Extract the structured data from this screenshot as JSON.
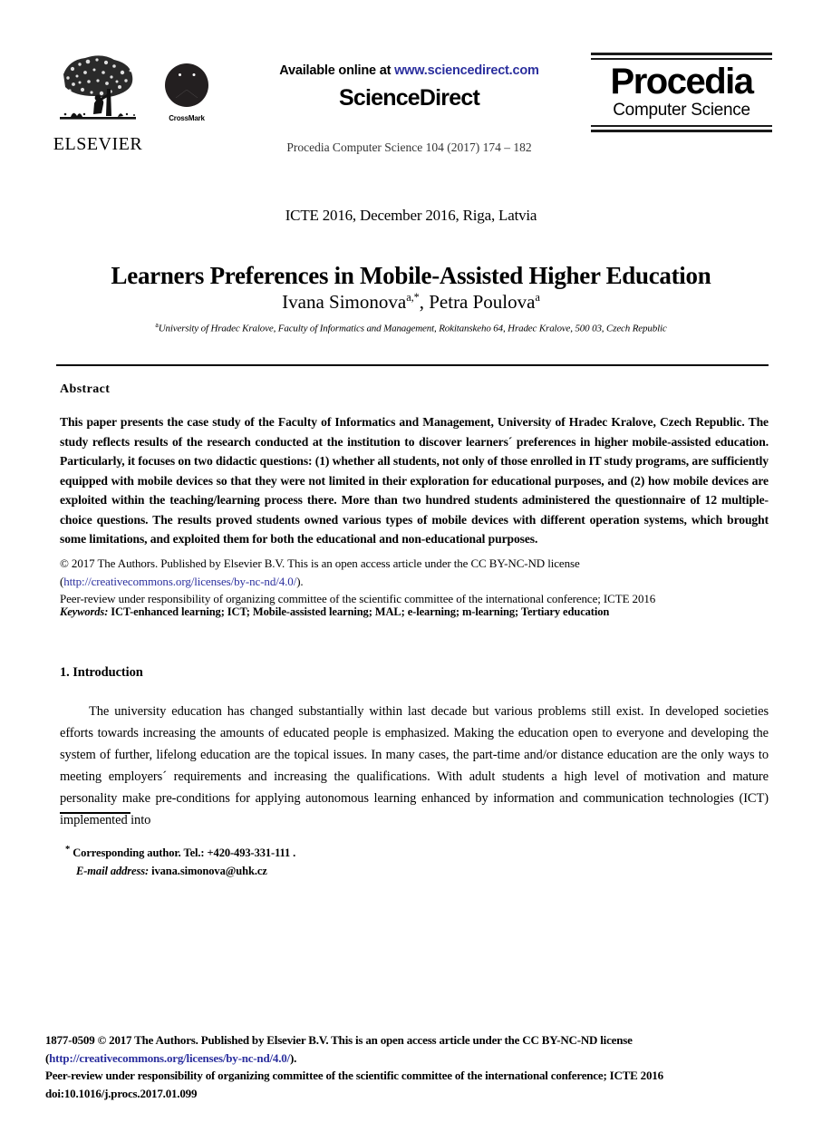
{
  "header": {
    "elsevier_label": "ELSEVIER",
    "crossmark_label": "CrossMark",
    "available_prefix": "Available online at ",
    "sciencedirect_url": "www.sciencedirect.com",
    "sciencedirect_brand": "ScienceDirect",
    "journal_line": "Procedia Computer Science 104 (2017) 174 – 182",
    "procedia_title": "Procedia",
    "procedia_subtitle": "Computer Science"
  },
  "title_block": {
    "conference": "ICTE 2016, December 2016, Riga, Latvia",
    "title": "Learners Preferences in Mobile-Assisted Higher Education",
    "author_one": "Ivana Simonova",
    "author_one_sup": "a,",
    "author_one_star": "*",
    "author_separator": ", ",
    "author_two": "Petra Poulova",
    "author_two_sup": "a",
    "affiliation_sup": "a",
    "affiliation": "University of Hradec Kralove, Faculty of Informatics and Management, Rokitanskeho 64, Hradec Kralove, 500 03, Czech Republic"
  },
  "abstract": {
    "heading": "Abstract",
    "text": "This paper presents the case study of the Faculty of Informatics and Management, University of Hradec Kralove, Czech Republic. The study reflects results of the research conducted at the institution to discover learners´ preferences in higher mobile-assisted education. Particularly, it focuses on two didactic questions: (1) whether all students, not only of those enrolled in IT study programs, are sufficiently equipped with mobile devices so that they were not limited in their exploration for educational purposes, and (2) how mobile devices are exploited within the teaching/learning process there. More than two hundred students administered the questionnaire of 12 multiple-choice questions. The results proved students owned various types of mobile devices with different operation systems, which brought some limitations, and exploited them for both the educational and non-educational purposes."
  },
  "license": {
    "line1": "© 2017 The Authors. Published by Elsevier B.V. This is an open access article under the CC BY-NC-ND license",
    "open_paren": "(",
    "link": "http://creativecommons.org/licenses/by-nc-nd/4.0/",
    "close_paren": ").",
    "line3": "Peer-review under responsibility of organizing committee of the scientific committee of the international conference; ICTE 2016"
  },
  "keywords": {
    "label": "Keywords:",
    "text": " ICT-enhanced learning; ICT; Mobile-assisted learning; MAL; e-learning; m-learning; Tertiary education"
  },
  "introduction": {
    "heading": "1. Introduction",
    "paragraph": "The university education has changed substantially within last decade but various problems still exist. In developed societies efforts towards increasing the amounts of educated people is emphasized. Making the education open to everyone and developing the system of further, lifelong education are the topical issues. In many cases, the part-time and/or distance education are the only ways to meeting employers´ requirements and increasing the qualifications. With adult students a high level of motivation and mature personality make pre-conditions for applying autonomous learning enhanced by information and communication technologies (ICT) implemented into"
  },
  "footnote": {
    "marker": "*",
    "corresponding": " Corresponding author. Tel.: +420-493-331-111 .",
    "email_label": "E-mail address:",
    "email": " ivana.simonova@uhk.cz"
  },
  "page_footer": {
    "line1": "1877-0509 © 2017 The Authors. Published by Elsevier B.V. This is an open access article under the CC BY-NC-ND license",
    "open_paren": "(",
    "link": "http://creativecommons.org/licenses/by-nc-nd/4.0/",
    "close_paren": ").",
    "line3": "Peer-review under responsibility of organizing committee of the scientific committee of the international conference; ICTE 2016",
    "doi": "doi:10.1016/j.procs.2017.01.099"
  },
  "colors": {
    "link": "#2b2f9e",
    "text": "#000000",
    "background": "#ffffff"
  }
}
